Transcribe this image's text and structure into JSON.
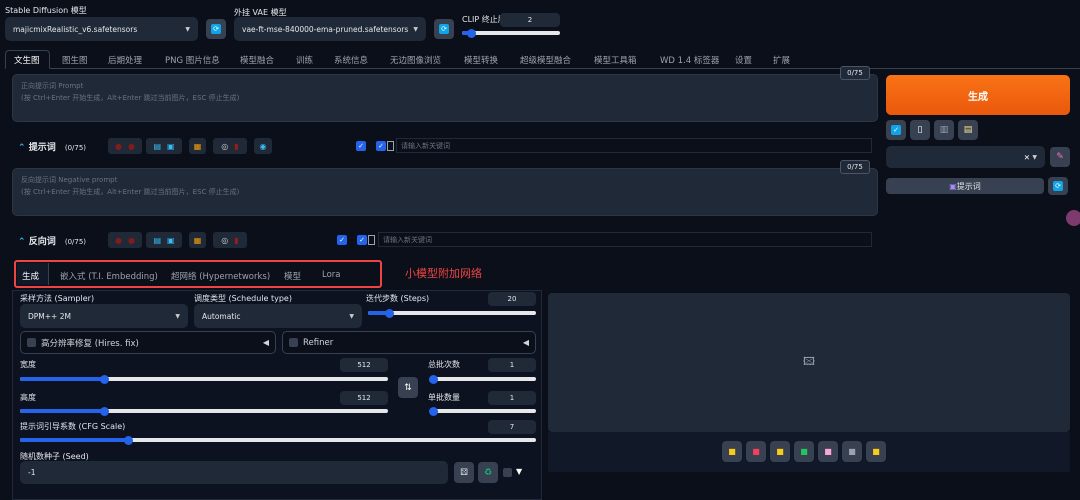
{
  "top": {
    "sd_label": "Stable Diffusion 模型",
    "sd_value": "majicmixRealistic_v6.safetensors",
    "vae_label": "外挂 VAE 模型",
    "vae_value": "vae-ft-mse-840000-ema-pruned.safetensors",
    "clip_label": "CLIP 终止层数",
    "clip_value": "2",
    "clip_fraction": 0.1
  },
  "tabs": [
    "文生图",
    "图生图",
    "后期处理",
    "PNG 图片信息",
    "模型融合",
    "训练",
    "系统信息",
    "无边图像浏览",
    "模型转换",
    "超级模型融合",
    "模型工具箱",
    "WD 1.4 标签器",
    "设置",
    "扩展"
  ],
  "prompt": {
    "placeholder1": "正向提示词 Prompt",
    "placeholder2": "(按 Ctrl+Enter 开始生成，Alt+Enter 跳过当前图片，ESC 停止生成)",
    "counter": "0/75",
    "label": "提示词",
    "count": "(0/75)",
    "keyword_placeholder": "请输入新关键词"
  },
  "negative": {
    "placeholder1": "反向提示词 Negative prompt",
    "placeholder2": "(按 Ctrl+Enter 开始生成，Alt+Enter 跳过当前图片，ESC 停止生成)",
    "counter": "0/75",
    "label": "反向词",
    "count": "(0/75)",
    "keyword_placeholder": "请输入新关键词"
  },
  "right": {
    "generate": "生成",
    "prompt_btn": "提示词"
  },
  "subtabs": [
    "生成",
    "嵌入式 (T.I. Embedding)",
    "超网络 (Hypernetworks)",
    "模型",
    "Lora"
  ],
  "annotation": "小模型附加网络",
  "params": {
    "sampler_label": "采样方法 (Sampler)",
    "sampler": "DPM++ 2M",
    "schedule_label": "调度类型 (Schedule type)",
    "schedule": "Automatic",
    "steps_label": "迭代步数 (Steps)",
    "steps": "20",
    "steps_fraction": 0.13,
    "hires": "高分辨率修复 (Hires. fix)",
    "refiner": "Refiner",
    "width_label": "宽度",
    "width": "512",
    "width_fraction": 0.23,
    "height_label": "高度",
    "height": "512",
    "height_fraction": 0.23,
    "batch_count_label": "总批次数",
    "batch_count": "1",
    "batch_count_fraction": 0,
    "batch_size_label": "单批数量",
    "batch_size": "1",
    "batch_size_fraction": 0,
    "cfg_label": "提示词引导系数 (CFG Scale)",
    "cfg": "7",
    "cfg_fraction": 0.21,
    "seed_label": "随机数种子 (Seed)",
    "seed": "-1"
  }
}
